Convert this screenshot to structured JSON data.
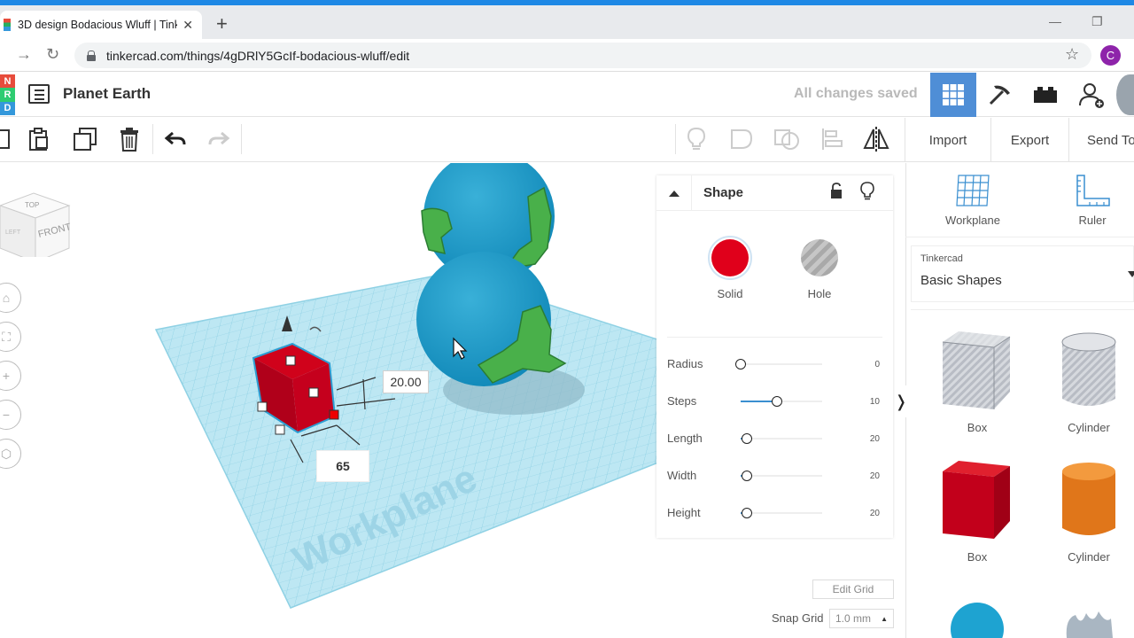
{
  "browser": {
    "tab_title": "3D design Bodacious Wluff | Tink",
    "new_tab_icon": "plus-icon",
    "url": "tinkercad.com/things/4gDRlY5GcIf-bodacious-wluff/edit",
    "profile_initial": "C",
    "profile_color": "#8e24aa"
  },
  "header": {
    "logo_letters": [
      "N",
      "R",
      "D"
    ],
    "design_title": "Planet Earth",
    "status": "All changes saved",
    "accent": "#4f8ed6"
  },
  "toolbar": {
    "import_label": "Import",
    "export_label": "Export",
    "send_to_label": "Send To"
  },
  "viewport": {
    "viewcube_top": "TOP",
    "viewcube_front": "FRONT",
    "viewcube_left": "LEFT",
    "workplane_text": "Workplane",
    "dim_height": "20.00",
    "dim_input": "65"
  },
  "inspector": {
    "title": "Shape",
    "solid_label": "Solid",
    "hole_label": "Hole",
    "solid_color": "#e0001b",
    "properties": [
      {
        "label": "Radius",
        "value": "0",
        "level": 0
      },
      {
        "label": "Steps",
        "value": "10",
        "level": 0.45
      },
      {
        "label": "Length",
        "value": "20",
        "level": 0.08
      },
      {
        "label": "Width",
        "value": "20",
        "level": 0.08
      },
      {
        "label": "Height",
        "value": "20",
        "level": 0.08
      }
    ]
  },
  "right_panel": {
    "workplane_label": "Workplane",
    "ruler_label": "Ruler",
    "library_source": "Tinkercad",
    "library_name": "Basic Shapes",
    "shapes": [
      {
        "label": "Box",
        "variant": "hole"
      },
      {
        "label": "Cylinder",
        "variant": "hole"
      },
      {
        "label": "Box",
        "variant": "solid"
      },
      {
        "label": "Cylinder",
        "variant": "solid"
      }
    ]
  },
  "footer": {
    "edit_grid": "Edit Grid",
    "snap_grid_label": "Snap Grid",
    "snap_grid_value": "1.0 mm"
  }
}
